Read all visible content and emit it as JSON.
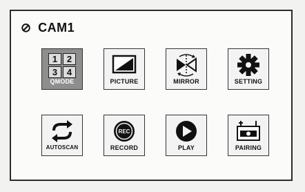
{
  "header": {
    "signal_icon": "signal-off-icon",
    "signal_glyph": "⊘",
    "title": "CAM1"
  },
  "qmode": {
    "cells": [
      "1",
      "2",
      "3",
      "4"
    ]
  },
  "menu": [
    {
      "label": "QMODE",
      "icon": "quad-grid-icon"
    },
    {
      "label": "PICTURE",
      "icon": "picture-icon"
    },
    {
      "label": "MIRROR",
      "icon": "mirror-icon"
    },
    {
      "label": "SETTING",
      "icon": "gear-icon"
    },
    {
      "label": "AUTOSCAN",
      "icon": "autoscan-icon"
    },
    {
      "label": "RECORD",
      "icon": "record-icon",
      "icon_text": "REC"
    },
    {
      "label": "PLAY",
      "icon": "play-icon"
    },
    {
      "label": "PAIRING",
      "icon": "pairing-icon"
    }
  ]
}
